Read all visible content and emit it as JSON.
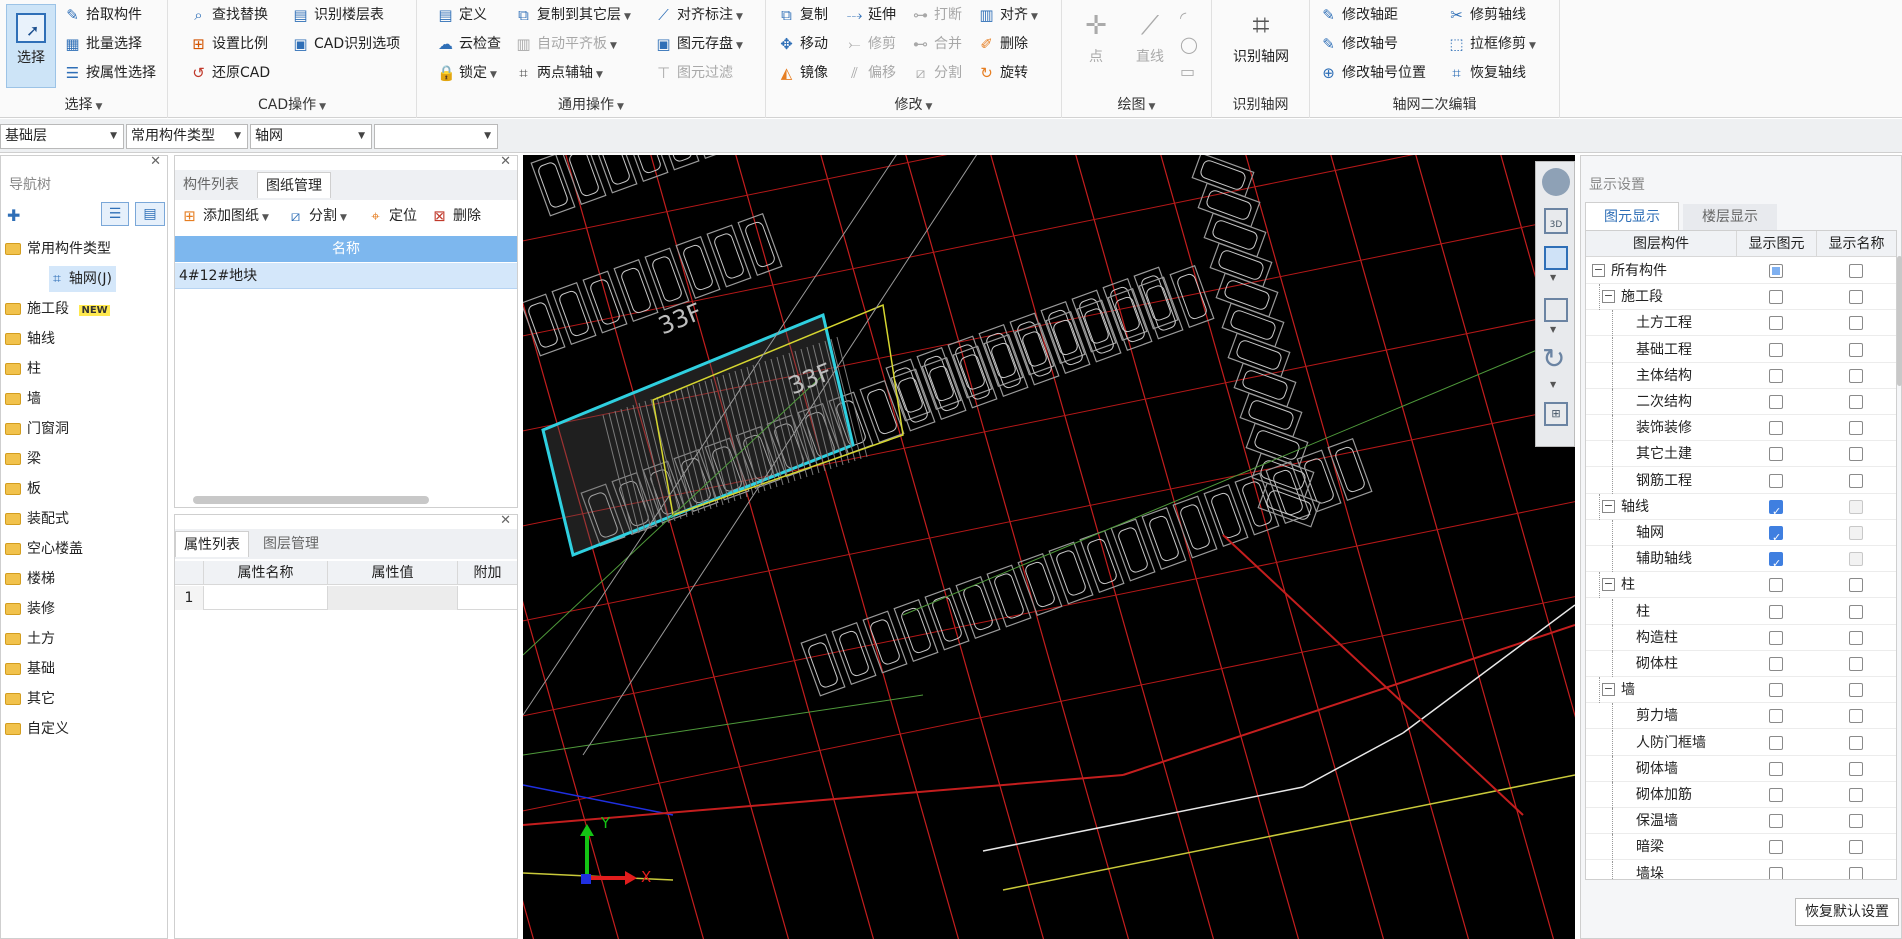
{
  "ribbon": {
    "select": {
      "big": "选择",
      "items": [
        "拾取构件",
        "批量选择",
        "按属性选择"
      ],
      "group": "选择"
    },
    "cad": {
      "items": [
        "查找替换",
        "设置比例",
        "还原CAD",
        "识别楼层表",
        "CAD识别选项"
      ],
      "group": "CAD操作"
    },
    "general": {
      "items": [
        "定义",
        "云检查",
        "锁定",
        "复制到其它层",
        "自动平齐板",
        "两点辅轴",
        "对齐标注",
        "图元存盘",
        "图元过滤"
      ],
      "group": "通用操作"
    },
    "modify": {
      "items": [
        "复制",
        "移动",
        "镜像",
        "延伸",
        "修剪",
        "偏移",
        "打断",
        "合并",
        "分割",
        "对齐",
        "删除",
        "旋转"
      ],
      "group": "修改"
    },
    "draw": {
      "items": [
        "点",
        "直线"
      ],
      "group": "绘图"
    },
    "identify": {
      "big": "识别轴网",
      "group": "识别轴网"
    },
    "axisedit": {
      "items": [
        "修改轴距",
        "修改轴号",
        "修改轴号位置",
        "修剪轴线",
        "拉框修剪",
        "恢复轴线"
      ],
      "group": "轴网二次编辑"
    }
  },
  "toolbar": {
    "floor": "基础层",
    "type": "常用构件类型",
    "component": "轴网",
    "extra": ""
  },
  "nav": {
    "title": "导航树",
    "items": [
      "常用构件类型",
      "轴网(J)",
      "施工段",
      "轴线",
      "柱",
      "墙",
      "门窗洞",
      "梁",
      "板",
      "装配式",
      "空心楼盖",
      "楼梯",
      "装修",
      "土方",
      "基础",
      "其它",
      "自定义"
    ],
    "new_badge": "NEW"
  },
  "drawing_panel": {
    "tabs": [
      "构件列表",
      "图纸管理"
    ],
    "actions": [
      "添加图纸",
      "分割",
      "定位",
      "删除"
    ],
    "col": "名称",
    "rows": [
      "4#12#地块"
    ]
  },
  "prop_panel": {
    "tabs": [
      "属性列表",
      "图层管理"
    ],
    "cols": [
      "属性名称",
      "属性值",
      "附加"
    ],
    "rownum": "1"
  },
  "canvas": {
    "labels": [
      "33F",
      "33F"
    ],
    "axis_x": "X",
    "axis_y": "Y"
  },
  "display": {
    "title": "显示设置",
    "tabs": [
      "图元显示",
      "楼层显示"
    ],
    "cols": [
      "图层构件",
      "显示图元",
      "显示名称"
    ],
    "rows": [
      {
        "label": "所有构件",
        "level": 0,
        "exp": "−",
        "show": "part",
        "name": "off"
      },
      {
        "label": "施工段",
        "level": 1,
        "exp": "−",
        "show": "off",
        "name": "off"
      },
      {
        "label": "土方工程",
        "level": 2,
        "show": "off",
        "name": "off"
      },
      {
        "label": "基础工程",
        "level": 2,
        "show": "off",
        "name": "off"
      },
      {
        "label": "主体结构",
        "level": 2,
        "show": "off",
        "name": "off"
      },
      {
        "label": "二次结构",
        "level": 2,
        "show": "off",
        "name": "off"
      },
      {
        "label": "装饰装修",
        "level": 2,
        "show": "off",
        "name": "off"
      },
      {
        "label": "其它土建",
        "level": 2,
        "show": "off",
        "name": "off"
      },
      {
        "label": "钢筋工程",
        "level": 2,
        "show": "off",
        "name": "off"
      },
      {
        "label": "轴线",
        "level": 1,
        "exp": "−",
        "show": "on",
        "name": "grey"
      },
      {
        "label": "轴网",
        "level": 2,
        "show": "on",
        "name": "grey"
      },
      {
        "label": "辅助轴线",
        "level": 2,
        "show": "on",
        "name": "grey"
      },
      {
        "label": "柱",
        "level": 1,
        "exp": "−",
        "show": "off",
        "name": "off"
      },
      {
        "label": "柱",
        "level": 2,
        "show": "off",
        "name": "off"
      },
      {
        "label": "构造柱",
        "level": 2,
        "show": "off",
        "name": "off"
      },
      {
        "label": "砌体柱",
        "level": 2,
        "show": "off",
        "name": "off"
      },
      {
        "label": "墙",
        "level": 1,
        "exp": "−",
        "show": "off",
        "name": "off"
      },
      {
        "label": "剪力墙",
        "level": 2,
        "show": "off",
        "name": "off"
      },
      {
        "label": "人防门框墙",
        "level": 2,
        "show": "off",
        "name": "off"
      },
      {
        "label": "砌体墙",
        "level": 2,
        "show": "off",
        "name": "off"
      },
      {
        "label": "砌体加筋",
        "level": 2,
        "show": "off",
        "name": "off"
      },
      {
        "label": "保温墙",
        "level": 2,
        "show": "off",
        "name": "off"
      },
      {
        "label": "暗梁",
        "level": 2,
        "show": "off",
        "name": "off"
      },
      {
        "label": "墙垛",
        "level": 2,
        "show": "off",
        "name": "off"
      }
    ],
    "reset": "恢复默认设置"
  }
}
